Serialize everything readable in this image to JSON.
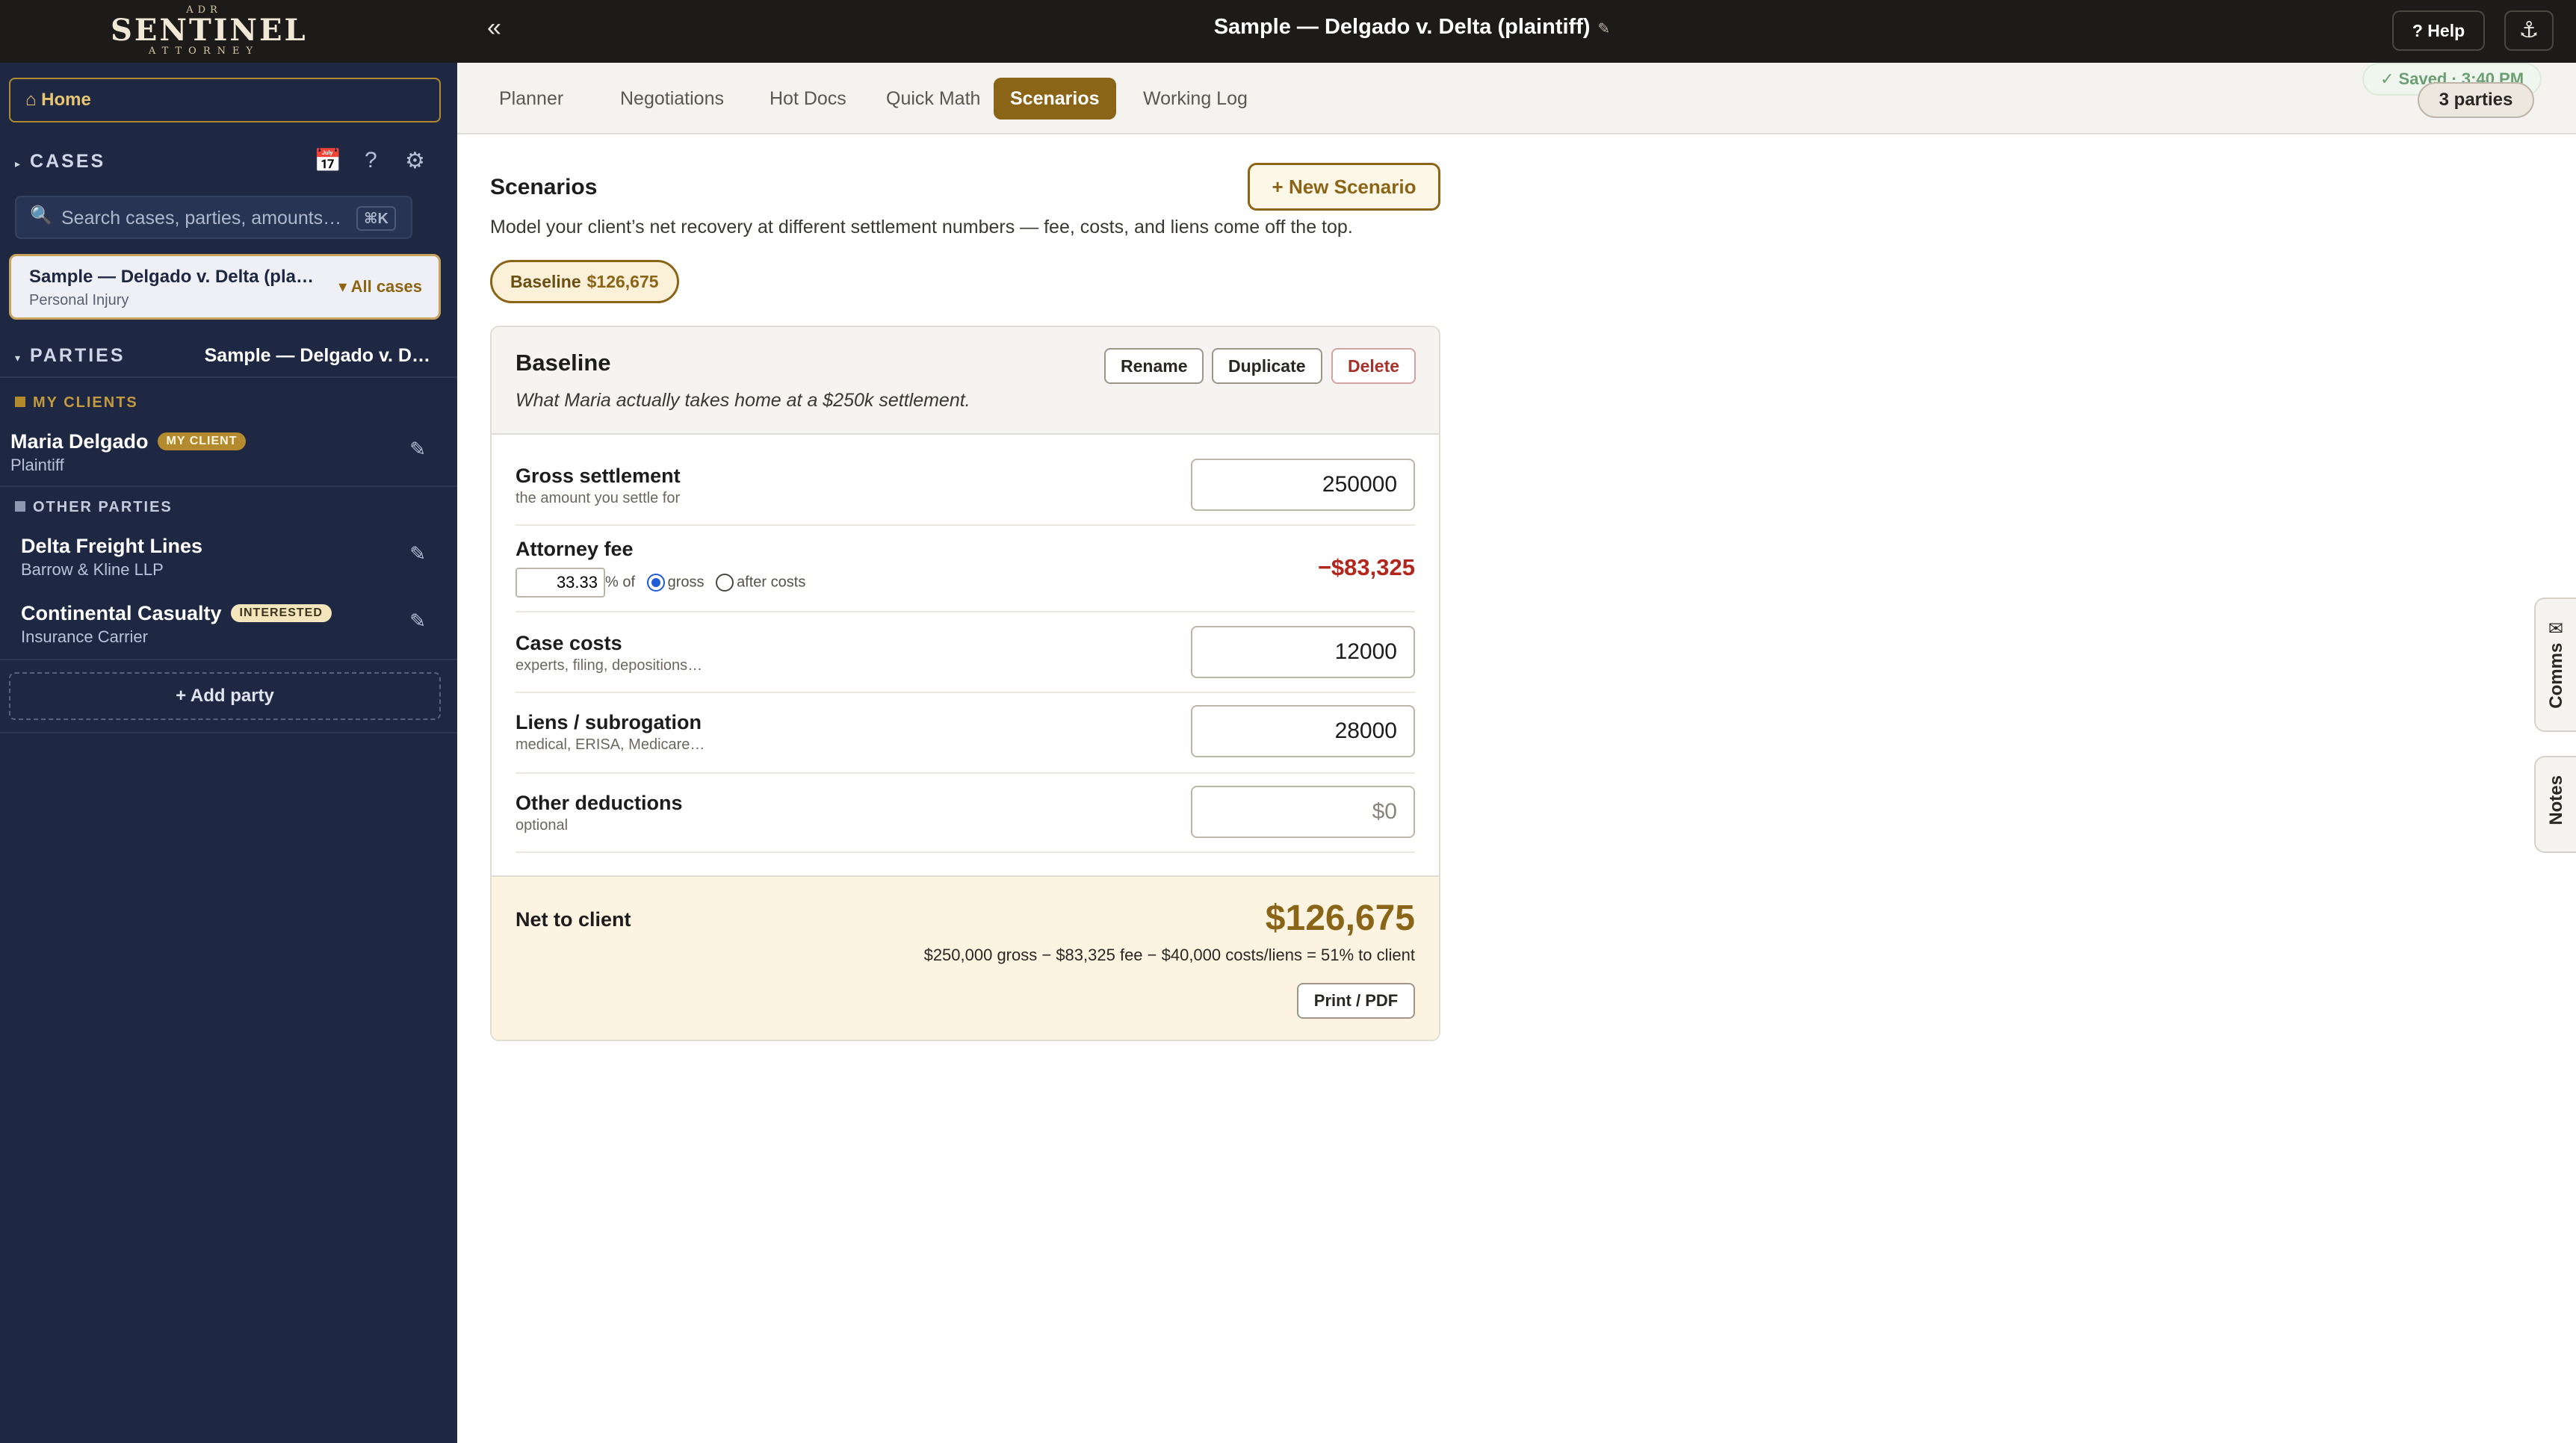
{
  "app": {
    "logo_top": "ADR",
    "logo_main": "SENTINEL",
    "logo_sub": "ATTORNEY",
    "collapse_label": "«",
    "case_title": "Sample — Delgado v. Delta (plaintiff)",
    "title_edit_icon": "pencil-icon",
    "help_label": "? Help",
    "anchor_icon": "⚓"
  },
  "sidebar": {
    "home_label": "⌂ Home",
    "cases_label": "CASES",
    "search_placeholder": "Search cases, parties, amounts…",
    "search_shortcut": "⌘K",
    "active_case": {
      "name": "Sample — Delgado v. Delta (pla…",
      "type": "Personal Injury",
      "all_cases_label": "▾ All cases"
    },
    "parties_label": "PARTIES",
    "parties_case": "Sample — Delgado v. D…",
    "my_clients_label": "MY CLIENTS",
    "other_parties_label": "OTHER PARTIES",
    "clients": [
      {
        "name": "Maria Delgado",
        "badge": "MY CLIENT",
        "role": "Plaintiff"
      }
    ],
    "others": [
      {
        "name": "Delta Freight Lines",
        "role": "Barrow & Kline LLP",
        "badge": ""
      },
      {
        "name": "Continental Casualty",
        "badge": "INTERESTED",
        "role": "Insurance Carrier"
      }
    ],
    "add_party_label": "+ Add party",
    "colors": {
      "bg": "#1e2843",
      "accent": "#b3892f"
    }
  },
  "tabs": [
    {
      "label": "Planner",
      "active": false
    },
    {
      "label": "Negotiations",
      "active": false
    },
    {
      "label": "Hot Docs",
      "active": false
    },
    {
      "label": "Quick Math",
      "active": false
    },
    {
      "label": "Scenarios",
      "active": true
    },
    {
      "label": "Working Log",
      "active": false
    }
  ],
  "status": {
    "saved": "✓ Saved · 3:40 PM",
    "parties_count": "3 parties"
  },
  "scenarios": {
    "title": "Scenarios",
    "new_label": "+ New Scenario",
    "description": "Model your client’s net recovery at different settlement numbers — fee, costs, and liens come off the top.",
    "pill_name": "Baseline",
    "pill_amount": "$126,675",
    "panel": {
      "title": "Baseline",
      "description": "What Maria actually takes home at a $250k settlement.",
      "rename_label": "Rename",
      "duplicate_label": "Duplicate",
      "delete_label": "Delete",
      "gross": {
        "label": "Gross settlement",
        "hint": "the amount you settle for",
        "value": "250000"
      },
      "fee": {
        "label": "Attorney fee",
        "percent": "33.33",
        "pct_suffix": "% of",
        "opt_gross": "gross",
        "opt_after": "after costs",
        "selected": "gross",
        "amount": "−$83,325"
      },
      "costs": {
        "label": "Case costs",
        "hint": "experts, filing, depositions…",
        "value": "12000"
      },
      "liens": {
        "label": "Liens / subrogation",
        "hint": "medical, ERISA, Medicare…",
        "value": "28000"
      },
      "other": {
        "label": "Other deductions",
        "hint": "optional",
        "value": "",
        "placeholder": "$0"
      },
      "net": {
        "label": "Net to client",
        "amount": "$126,675",
        "calc": "$250,000 gross − $83,325 fee − $40,000 costs/liens = 51% to client",
        "print_label": "Print / PDF"
      }
    }
  },
  "side_tabs": {
    "comms_label": "Comms ✉",
    "notes_label": "Notes"
  },
  "colors": {
    "accent_gold": "#8a6417",
    "negative_red": "#b3261e",
    "topbar": "#1d1b19"
  }
}
